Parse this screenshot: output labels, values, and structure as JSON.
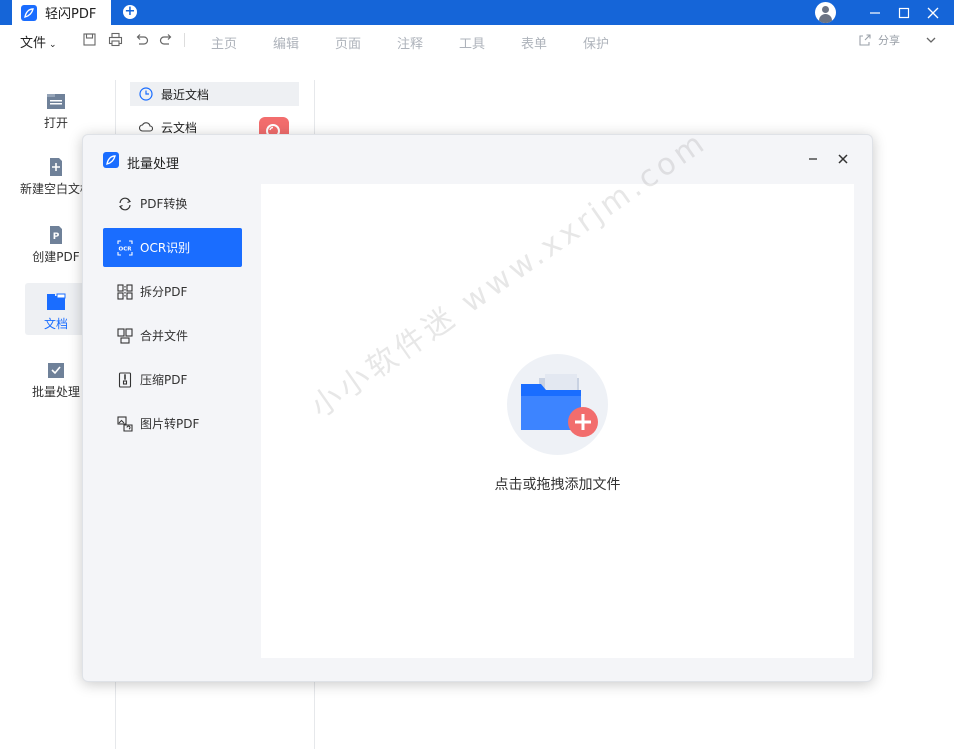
{
  "titlebar": {
    "tab_title": "轻闪PDF",
    "new_tab": "+",
    "accent": "#1565d8"
  },
  "menubar": {
    "file": "文件",
    "items": [
      "主页",
      "编辑",
      "页面",
      "注释",
      "工具",
      "表单",
      "保护"
    ],
    "share": "分享"
  },
  "rail": [
    {
      "label": "打开",
      "icon": "folder-open-icon"
    },
    {
      "label": "新建空白文档",
      "icon": "new-doc-icon"
    },
    {
      "label": "创建PDF",
      "icon": "create-pdf-icon"
    },
    {
      "label": "文档",
      "icon": "documents-icon"
    },
    {
      "label": "批量处理",
      "icon": "batch-icon"
    }
  ],
  "doc_list": [
    {
      "label": "最近文档",
      "icon": "clock-icon"
    },
    {
      "label": "云文档",
      "icon": "cloud-icon"
    }
  ],
  "dialog": {
    "title": "批量处理",
    "nav": [
      {
        "label": "PDF转换",
        "icon": "convert-icon"
      },
      {
        "label": "OCR识别",
        "icon": "ocr-icon"
      },
      {
        "label": "拆分PDF",
        "icon": "split-icon"
      },
      {
        "label": "合并文件",
        "icon": "merge-icon"
      },
      {
        "label": "压缩PDF",
        "icon": "compress-icon"
      },
      {
        "label": "图片转PDF",
        "icon": "image-to-pdf-icon"
      }
    ],
    "active_nav": "OCR识别",
    "drop_text": "点击或拖拽添加文件"
  },
  "watermark": "小小软件迷 www.xxrjm.com",
  "colors": {
    "accent": "#1a6dff",
    "badge": "#f26d6d",
    "plus": "#f26d6d"
  }
}
